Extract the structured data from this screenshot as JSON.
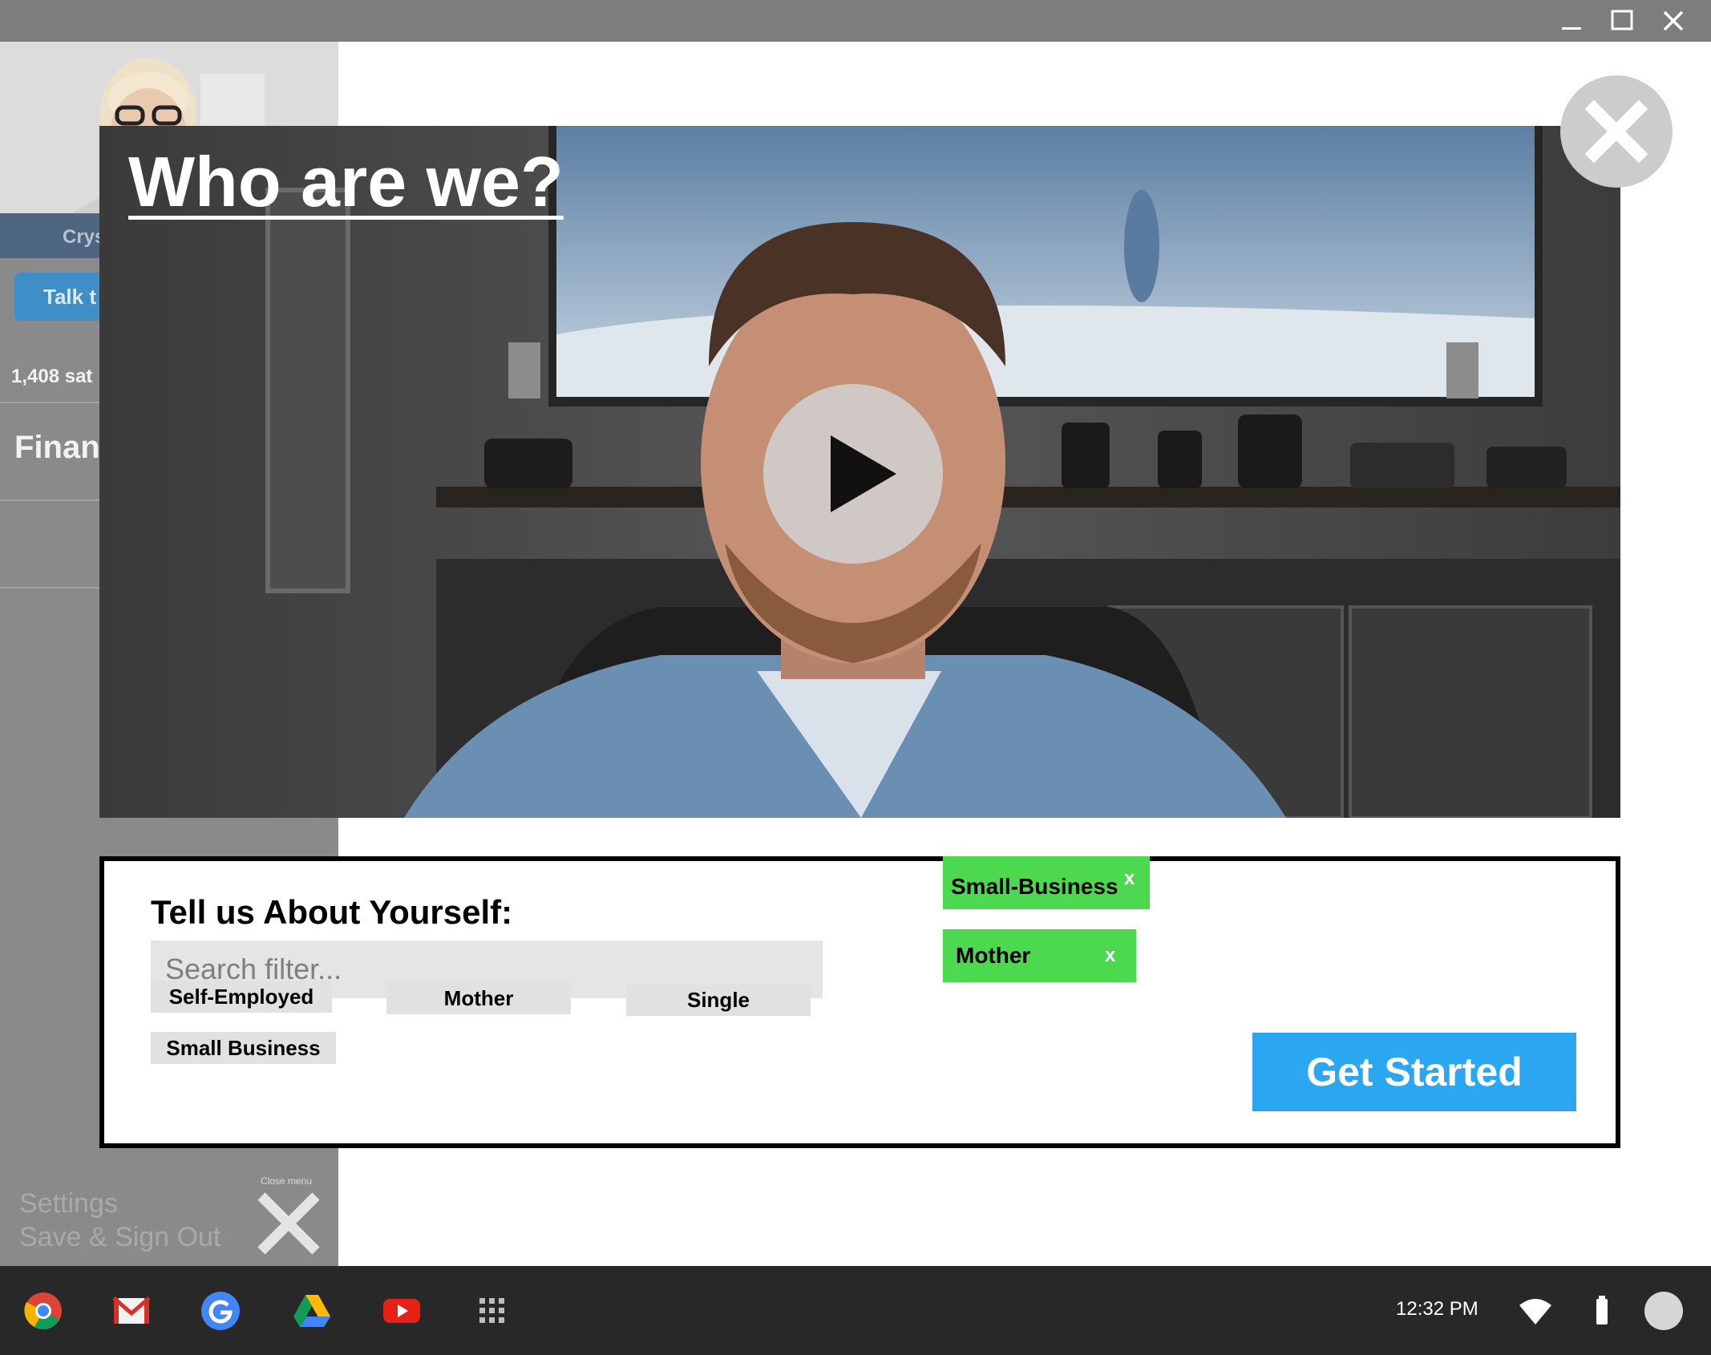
{
  "window": {
    "controls": [
      "minimize-icon",
      "maximize-icon",
      "close-icon"
    ]
  },
  "sidebar": {
    "profile_name": "Crys",
    "talk_button": "Talk t",
    "satisfaction": "1,408 sat",
    "section_heading": "Finan",
    "settings_label": "Settings",
    "signout_label": "Save & Sign Out",
    "close_menu_label": "Close menu"
  },
  "modal": {
    "title": "Who are we?",
    "panel_title": "Tell us About Yourself:",
    "search_placeholder": "Search filter...",
    "filter_chips": [
      "Self-Employed",
      "Mother",
      "Single",
      "Small Business"
    ],
    "selected_tags": [
      "Small-Business",
      "Mother"
    ],
    "tag_remove_glyph": "x",
    "cta_label": "Get Started"
  },
  "taskbar": {
    "apps": [
      "chrome-icon",
      "gmail-icon",
      "google-icon",
      "drive-icon",
      "youtube-icon",
      "launcher-icon"
    ],
    "time": "12:32 PM"
  },
  "colors": {
    "tag_green": "#4cd84f",
    "cta_blue": "#2ba6f0",
    "sidebar_gray": "#8a8a8a"
  }
}
